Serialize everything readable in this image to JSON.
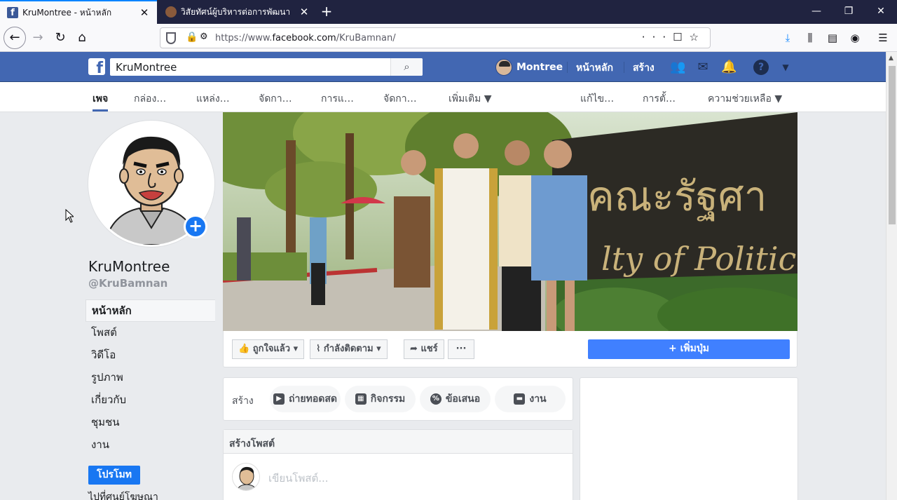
{
  "browser": {
    "tabs": [
      {
        "title": "KruMontree - หน้าหลัก",
        "active": true
      },
      {
        "title": "วิสัยทัศน์ผู้บริหารต่อการพัฒนา ICT",
        "active": false
      }
    ],
    "url_prefix": "https://www.",
    "url_domain": "facebook.com",
    "url_path": "/KruBamnan/",
    "window_controls": [
      "—",
      "❐",
      "✕"
    ]
  },
  "fb": {
    "search_value": "KruMontree",
    "user_name": "Montree",
    "home": "หน้าหลัก",
    "create": "สร้าง"
  },
  "page_tabs": [
    "เพจ",
    "กล่อง…",
    "แหล่ง…",
    "จัดกา…",
    "การแ…",
    "จัดกา…",
    "เพิ่มเติม ▼",
    "แก้ไข…",
    "การตั้…",
    "ความช่วยเหลือ ▼"
  ],
  "profile": {
    "name": "KruMontree",
    "handle": "@KruBamnan"
  },
  "left_nav": [
    "หน้าหลัก",
    "โพสต์",
    "วิดีโอ",
    "รูปภาพ",
    "เกี่ยวกับ",
    "ชุมชน",
    "งาน"
  ],
  "promote_label": "โปรโมท",
  "ad_center": "ไปที่ศูนย์โฆษณา",
  "cover_text": {
    "line1": "คณะรัฐศา",
    "line2": "lty of Political"
  },
  "cover_actions": {
    "liked": "ถูกใจแล้ว ▾",
    "following": "กำลังติดตาม ▾",
    "share": "แชร์",
    "more": "···",
    "add_button": "+ เพิ่มปุ่ม"
  },
  "create_strip": {
    "label": "สร้าง",
    "pills": [
      "ถ่ายทอดสด",
      "กิจกรรม",
      "ข้อเสนอ",
      "งาน"
    ]
  },
  "post": {
    "header": "สร้างโพสต์",
    "placeholder": "เขียนโพสต์..."
  },
  "colors": {
    "fb_blue": "#4267b2",
    "button_blue": "#1877f2"
  }
}
